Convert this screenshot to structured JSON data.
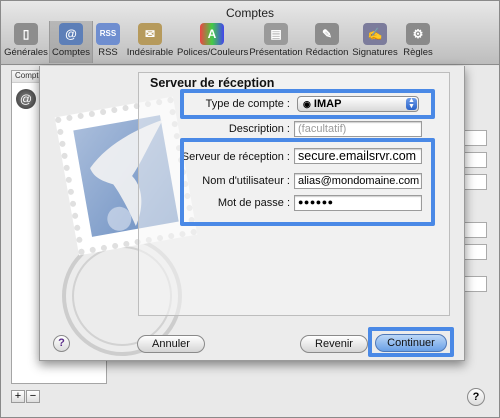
{
  "window": {
    "title": "Comptes"
  },
  "toolbar": {
    "items": [
      {
        "label": "Générales",
        "icon": "switch-icon"
      },
      {
        "label": "Comptes",
        "icon": "at-icon"
      },
      {
        "label": "RSS",
        "icon": "rss-icon"
      },
      {
        "label": "Indésirable",
        "icon": "trash-icon"
      },
      {
        "label": "Polices/Couleurs",
        "icon": "fonts-icon"
      },
      {
        "label": "Présentation",
        "icon": "presentation-icon"
      },
      {
        "label": "Rédaction",
        "icon": "compose-icon"
      },
      {
        "label": "Signatures",
        "icon": "signature-icon"
      },
      {
        "label": "Règles",
        "icon": "rules-icon"
      }
    ]
  },
  "accounts": {
    "header": "Comptes"
  },
  "sheet": {
    "heading": "Serveur de réception",
    "labels": {
      "account_type": "Type de compte :",
      "description": "Description :",
      "incoming_server": "Serveur de réception :",
      "username": "Nom d'utilisateur :",
      "password": "Mot de passe :"
    },
    "account_type_value": "IMAP",
    "description_placeholder": "(facultatif)",
    "incoming_server_value": "secure.emailsrvr.com",
    "username_value": "alias@mondomaine.com",
    "password_value": "●●●●●●",
    "buttons": {
      "cancel": "Annuler",
      "back": "Revenir",
      "continue": "Continuer"
    }
  },
  "colors": {
    "highlight": "#4a89e6"
  }
}
